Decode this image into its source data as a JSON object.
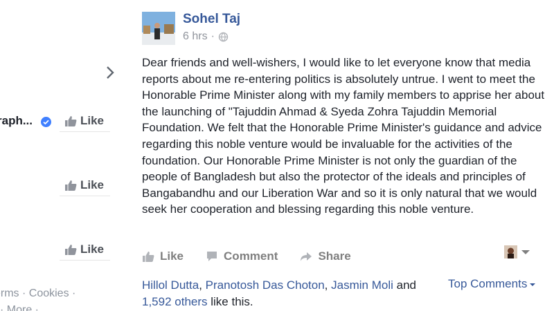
{
  "sidebar": {
    "page_name": "raph...",
    "like_label": "Like",
    "footer_line1": "erms · Cookies ·",
    "footer_line2": "· More ·"
  },
  "post": {
    "author": "Sohel Taj",
    "timestamp": "6 hrs",
    "separator": "·",
    "text": "Dear friends and well-wishers, I would like to let everyone know that media reports about me re-entering politics is absolutely untrue. I went to meet the Honorable Prime Minister along with my family members to apprise her about the launching of \"Tajuddin Ahmad & Syeda Zohra Tajuddin Memorial Foundation. We felt that the Honorable Prime Minister's guidance and advice regarding this noble venture would be invaluable for the activities of the foundation. Our Honorable Prime Minister is not only the guardian of the people of Bangladesh but also the protector of the ideals and principles of Bangabandhu and our Liberation War and so it is only natural that we would seek her cooperation and blessing regarding this noble venture.",
    "actions": {
      "like": "Like",
      "comment": "Comment",
      "share": "Share"
    },
    "likers": [
      "Hillol Dutta",
      "Pranotosh Das Choton",
      "Jasmin Moli"
    ],
    "sep_comma": ",",
    "and_word": "and",
    "others": "1,592 others",
    "like_suffix": "like this.",
    "top_comments": "Top Comments"
  },
  "colors": {
    "link": "#365899",
    "muted": "#90949c",
    "verified": "#4080ff"
  },
  "icons": [
    "chevron-right-icon",
    "verified-badge-icon",
    "thumbs-up-icon",
    "globe-icon",
    "comment-icon",
    "share-icon"
  ]
}
